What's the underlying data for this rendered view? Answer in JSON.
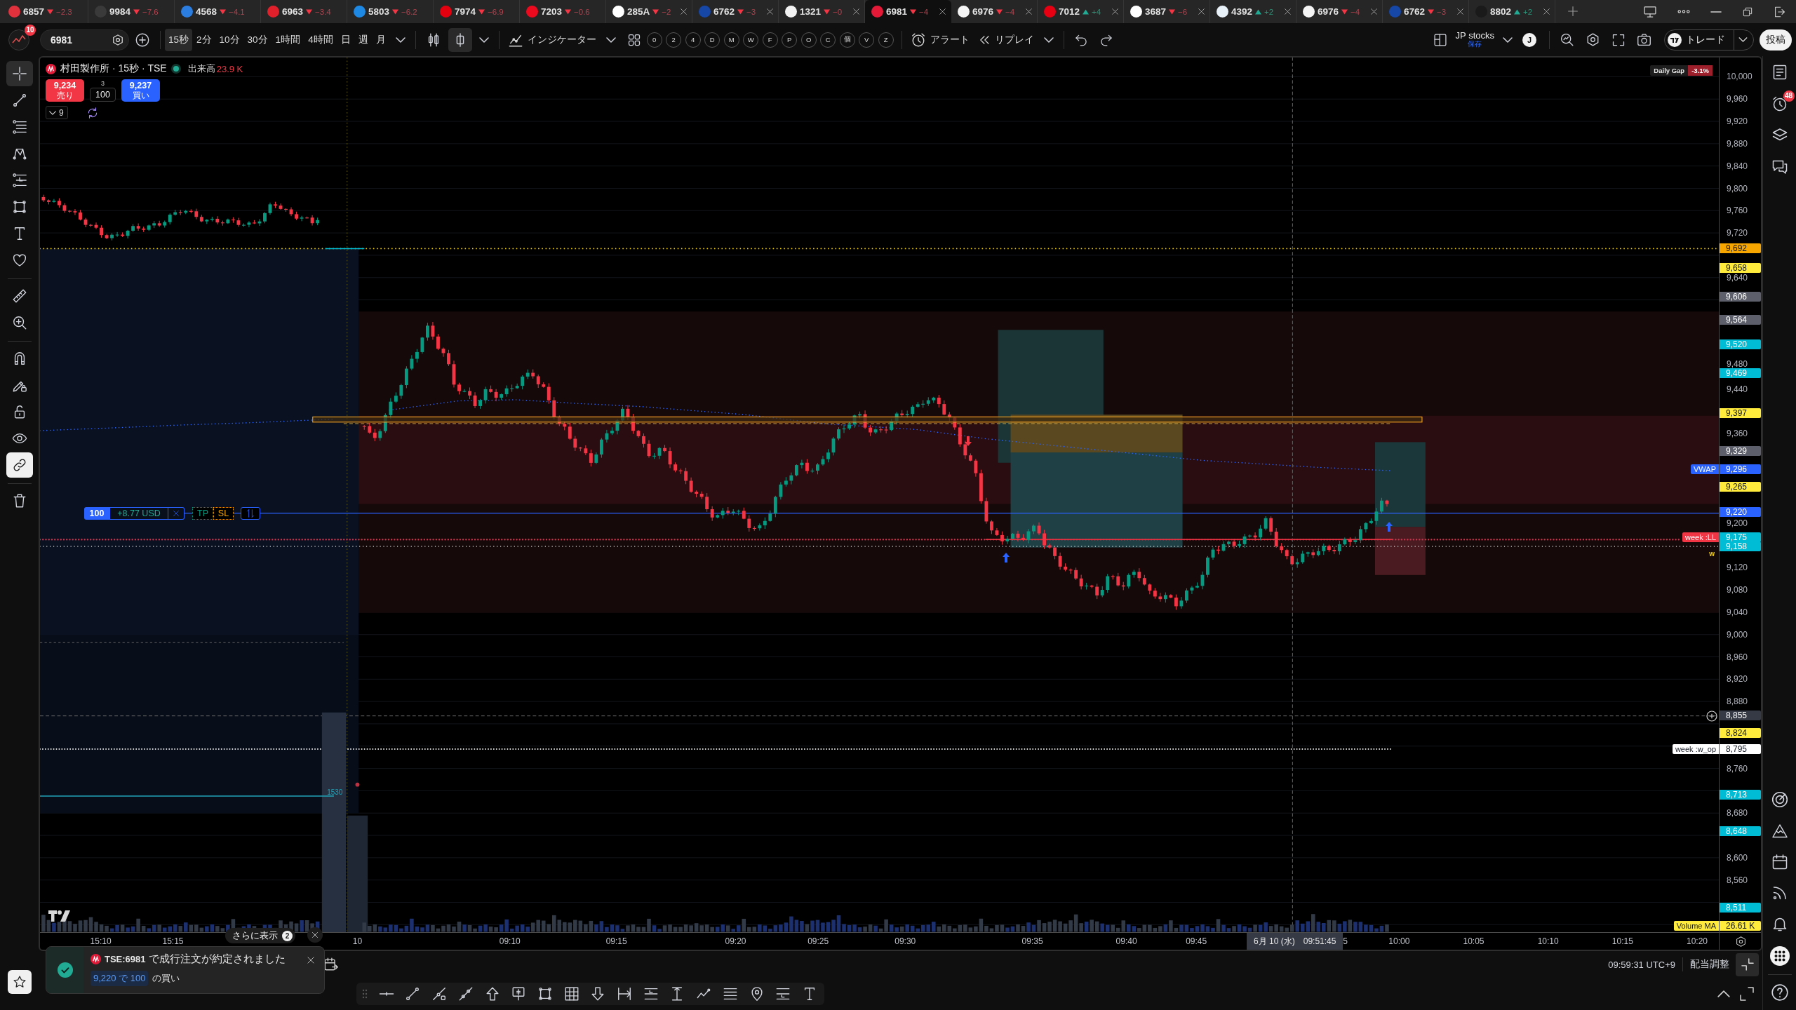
{
  "tabs": [
    {
      "ticker": "6857",
      "change": "−2.3",
      "rising": false,
      "color": "#e0313d",
      "closable": false,
      "selected": false
    },
    {
      "ticker": "9984",
      "change": "−7.6",
      "rising": false,
      "color": "#3a3a3a",
      "closable": false,
      "selected": false
    },
    {
      "ticker": "4568",
      "change": "−4.1",
      "rising": false,
      "color": "#2b7de0",
      "closable": false,
      "selected": false
    },
    {
      "ticker": "6963",
      "change": "−3.4",
      "rising": false,
      "color": "#e0202a",
      "closable": false,
      "selected": false
    },
    {
      "ticker": "5803",
      "change": "−6.2",
      "rising": false,
      "color": "#1e88e5",
      "closable": false,
      "selected": false
    },
    {
      "ticker": "7974",
      "change": "−6.9",
      "rising": false,
      "color": "#e4000f",
      "closable": false,
      "selected": false
    },
    {
      "ticker": "7203",
      "change": "−0.6",
      "rising": false,
      "color": "#eb0a1e",
      "closable": false,
      "selected": false
    },
    {
      "ticker": "285A",
      "change": "−2",
      "rising": false,
      "color": "#ffffff",
      "closable": true,
      "selected": false
    },
    {
      "ticker": "6762",
      "change": "−3",
      "rising": false,
      "color": "#1646a6",
      "closable": true,
      "selected": false
    },
    {
      "ticker": "1321",
      "change": "−0",
      "rising": false,
      "color": "#f2f2f2",
      "closable": true,
      "selected": false
    },
    {
      "ticker": "6981",
      "change": "−4",
      "rising": false,
      "color": "#e31937",
      "closable": true,
      "selected": true
    },
    {
      "ticker": "6976",
      "change": "−4",
      "rising": false,
      "color": "#f4f4f4",
      "closable": true,
      "selected": false
    },
    {
      "ticker": "7012",
      "change": "+4",
      "rising": true,
      "color": "#e60012",
      "closable": true,
      "selected": false
    },
    {
      "ticker": "3687",
      "change": "−6",
      "rising": false,
      "color": "#ffffff",
      "closable": true,
      "selected": false
    },
    {
      "ticker": "4392",
      "change": "+2",
      "rising": true,
      "color": "#e8f0f8",
      "closable": true,
      "selected": false
    },
    {
      "ticker": "6976",
      "change": "−4",
      "rising": false,
      "color": "#f4f4f4",
      "closable": true,
      "selected": false
    },
    {
      "ticker": "6762",
      "change": "−3",
      "rising": false,
      "color": "#1646a6",
      "closable": true,
      "selected": false
    },
    {
      "ticker": "8802",
      "change": "+2",
      "rising": true,
      "color": "#1a1a1a",
      "closable": true,
      "selected": false
    }
  ],
  "toolbar": {
    "notification_count": "10",
    "symbol": "6981",
    "intervals": [
      {
        "label": "15秒",
        "selected": true
      },
      {
        "label": "2分",
        "selected": false
      },
      {
        "label": "10分",
        "selected": false
      },
      {
        "label": "30分",
        "selected": false
      },
      {
        "label": "1時間",
        "selected": false
      },
      {
        "label": "4時間",
        "selected": false
      },
      {
        "label": "日",
        "selected": false
      },
      {
        "label": "週",
        "selected": false
      },
      {
        "label": "月",
        "selected": false
      }
    ],
    "chart_types": [
      {
        "selected": false
      },
      {
        "selected": true
      }
    ],
    "indicators_label": "インジケーター",
    "hotkeys": [
      "0",
      "2",
      "4",
      "D",
      "M",
      "W",
      "F",
      "P",
      "O",
      "C",
      "個",
      "V",
      "Z"
    ],
    "alert_label": "アラート",
    "replay_label": "リプレイ",
    "layout_name": "JP stocks",
    "layout_status": "保存",
    "user_initial": "J",
    "trade_label": "トレード",
    "publish_label": "投稿"
  },
  "left_toolbar": {
    "tools": [
      {
        "selected": true
      },
      {
        "selected": false
      },
      {
        "selected": false
      },
      {
        "selected": false
      },
      {
        "selected": false
      },
      {
        "selected": false
      },
      {
        "selected": false
      },
      {
        "selected": false
      },
      {
        "selected": false
      },
      {
        "selected": false
      }
    ],
    "toggles": [
      {
        "on": false
      },
      {
        "on": false
      },
      {
        "on": false
      },
      {
        "on": false
      },
      {
        "on": true
      }
    ]
  },
  "legend": {
    "title": "村田製作所 · 15秒 · TSE",
    "market_open": true,
    "volume_label": "出来高",
    "volume_value": "23.9 K"
  },
  "order_panel": {
    "sell_price": "9,234",
    "sell_label": "売り",
    "spread": "3",
    "quantity": "100",
    "buy_price": "9,237",
    "buy_label": "買い"
  },
  "indicators_toggle": {
    "count": "9",
    "expanded": false
  },
  "daily_gap": {
    "label": "Daily Gap",
    "value": "-3.1%"
  },
  "order_line": {
    "quantity": "100",
    "pnl": "+8.77 USD",
    "take_profit": "TP",
    "stop_loss": "SL"
  },
  "indicator_label": "w",
  "level_label": "1530",
  "price_axis": {
    "ticks": [
      "10,000",
      "9,960",
      "9,920",
      "9,880",
      "9,840",
      "9,800",
      "9,760",
      "9,720",
      "9,640",
      "9,480",
      "9,440",
      "9,360",
      "9,200",
      "9,120",
      "9,080",
      "9,040",
      "9,000",
      "8,960",
      "8,920",
      "8,880",
      "8,760",
      "8,680",
      "8,600",
      "8,560"
    ],
    "markers": [
      {
        "value": "9,692",
        "color": "#f7a600"
      },
      {
        "value": "9,658",
        "color": "#ffeb3b"
      },
      {
        "value": "9,606",
        "color": "#5d606b"
      },
      {
        "value": "9,564",
        "color": "#5d606b"
      },
      {
        "value": "9,520",
        "color": "#00bcd4"
      },
      {
        "value": "9,469",
        "color": "#00bcd4"
      },
      {
        "value": "9,397",
        "color": "#ffeb3b"
      },
      {
        "value": "9,329",
        "color": "#5d606b"
      },
      {
        "value": "9,296",
        "color": "#2962ff",
        "tag": {
          "text": "VWAP",
          "color": "#2962ff"
        }
      },
      {
        "value": "9,265",
        "color": "#ffeb3b"
      },
      {
        "value": "9,220",
        "color": "#2962ff"
      },
      {
        "value": "9,175",
        "color": "#00bcd4",
        "tag": {
          "text": "week :LL",
          "color": "#f23645"
        }
      },
      {
        "value": "9,158",
        "color": "#00bcd4"
      },
      {
        "value": "8,855",
        "color": "#363a45"
      },
      {
        "value": "8,824",
        "color": "#ffeb3b"
      },
      {
        "value": "8,795",
        "color": "#ffffff",
        "tag": {
          "text": "week :w_op",
          "color": "#ffffff"
        }
      },
      {
        "value": "8,713",
        "color": "#00bcd4"
      },
      {
        "value": "8,648",
        "color": "#00bcd4"
      },
      {
        "value": "8,511",
        "color": "#00bcd4"
      },
      {
        "value": "26.61 K",
        "color": "#ffeb3b",
        "tag": {
          "text": "Volume MA",
          "color": "#ffeb3b"
        }
      }
    ]
  },
  "time_axis": {
    "labels": [
      "15:10",
      "15:15",
      "10",
      "09:10",
      "09:15",
      "09:20",
      "09:25",
      "09:30",
      "09:35",
      "09:40",
      "09:45",
      "5",
      "10:00",
      "10:05",
      "10:10",
      "10:15",
      "10:20"
    ],
    "crosshair_date": "6月 10 (水)",
    "crosshair_time": "09:51:45"
  },
  "status_bar": {
    "clock": "09:59:31 UTC+9",
    "adjust_label": "配当調整"
  },
  "toast": {
    "more_label": "さらに表示",
    "more_count": "2",
    "message": "**TSE:6981** で成行注文が約定されました",
    "fill": "9,220 で 100",
    "side": "の買い"
  },
  "right_sidebar": {
    "alerts_count": "48"
  }
}
